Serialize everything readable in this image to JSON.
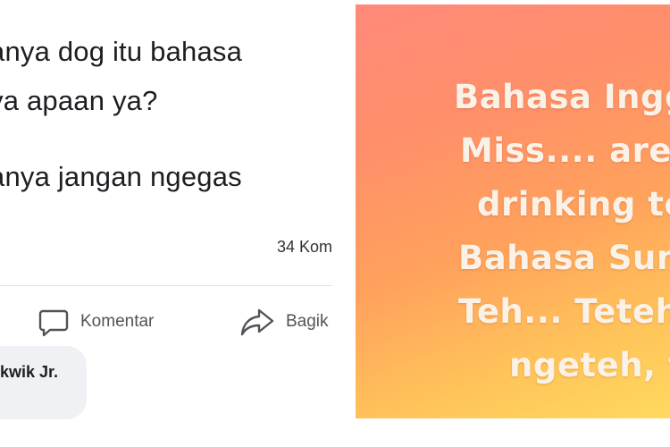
{
  "post": {
    "lines": [
      "anya dog itu bahasa",
      "ya apaan ya?",
      "anya jangan ngegas"
    ],
    "comment_count": "34 Kom",
    "actions": {
      "comment_label": "Komentar",
      "share_label": "Bagik"
    },
    "comment_author": "kwik Jr."
  },
  "image": {
    "lines": [
      "Bahasa Ingg",
      "Miss.... are",
      "drinking te",
      "Bahasa Sun",
      "Teh... Teteh",
      "ngeteh, te"
    ]
  },
  "icons": {
    "comment": "comment-bubble-icon",
    "share": "share-arrow-icon"
  },
  "colors": {
    "gradient_top": "#ff8a7a",
    "gradient_bottom": "#ffd95e",
    "text_on_image": "#fbf2e7"
  }
}
